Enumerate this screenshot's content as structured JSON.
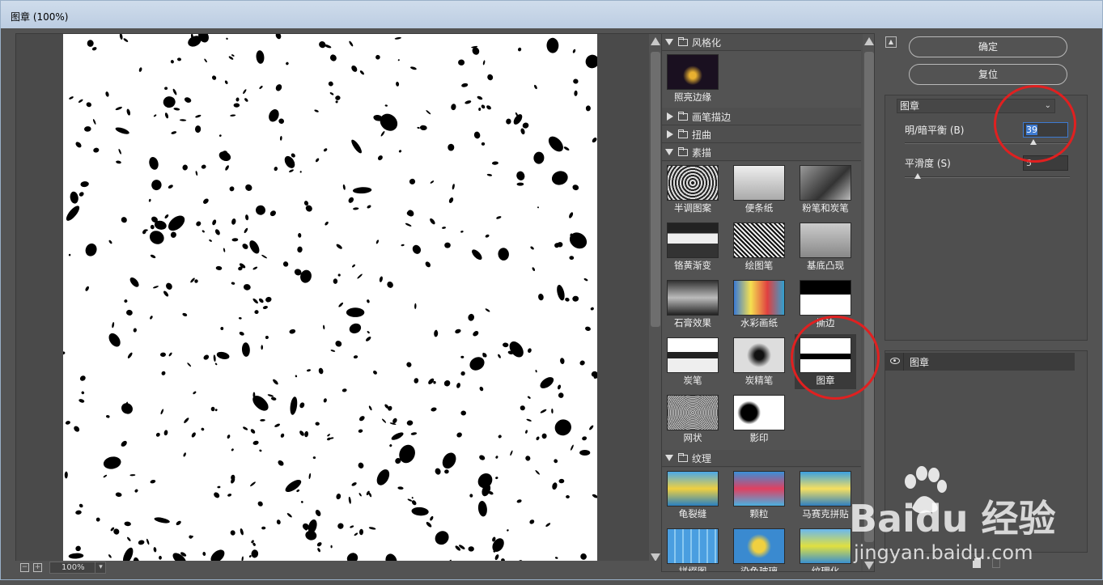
{
  "window": {
    "title": "图章 (100%)"
  },
  "preview": {
    "zoom": "100%"
  },
  "gallery": {
    "categories": [
      {
        "name": "风格化",
        "expanded": true,
        "items": [
          "照亮边缘"
        ]
      },
      {
        "name": "画笔描边",
        "expanded": false
      },
      {
        "name": "扭曲",
        "expanded": false
      },
      {
        "name": "素描",
        "expanded": true,
        "items": [
          "半调图案",
          "便条纸",
          "粉笔和炭笔",
          "铬黄渐变",
          "绘图笔",
          "基底凸现",
          "石膏效果",
          "水彩画纸",
          "撕边",
          "炭笔",
          "炭精笔",
          "图章",
          "网状",
          "影印"
        ]
      },
      {
        "name": "纹理",
        "expanded": true,
        "items": [
          "龟裂缝",
          "颗粒",
          "马赛克拼贴",
          "拼缀图",
          "染色玻璃",
          "纹理化"
        ]
      }
    ],
    "selected": "图章"
  },
  "buttons": {
    "ok": "确定",
    "reset": "复位"
  },
  "settings": {
    "filter": "图章",
    "params": [
      {
        "label": "明/暗平衡 (B)",
        "value": "39",
        "fraction": 0.78
      },
      {
        "label": "平滑度 (S)",
        "value": "5",
        "fraction": 0.08
      }
    ]
  },
  "layers": {
    "items": [
      {
        "name": "图章",
        "visible": true
      }
    ]
  },
  "watermark": {
    "brand": "Baidu 经验",
    "url": "jingyan.baidu.com"
  }
}
